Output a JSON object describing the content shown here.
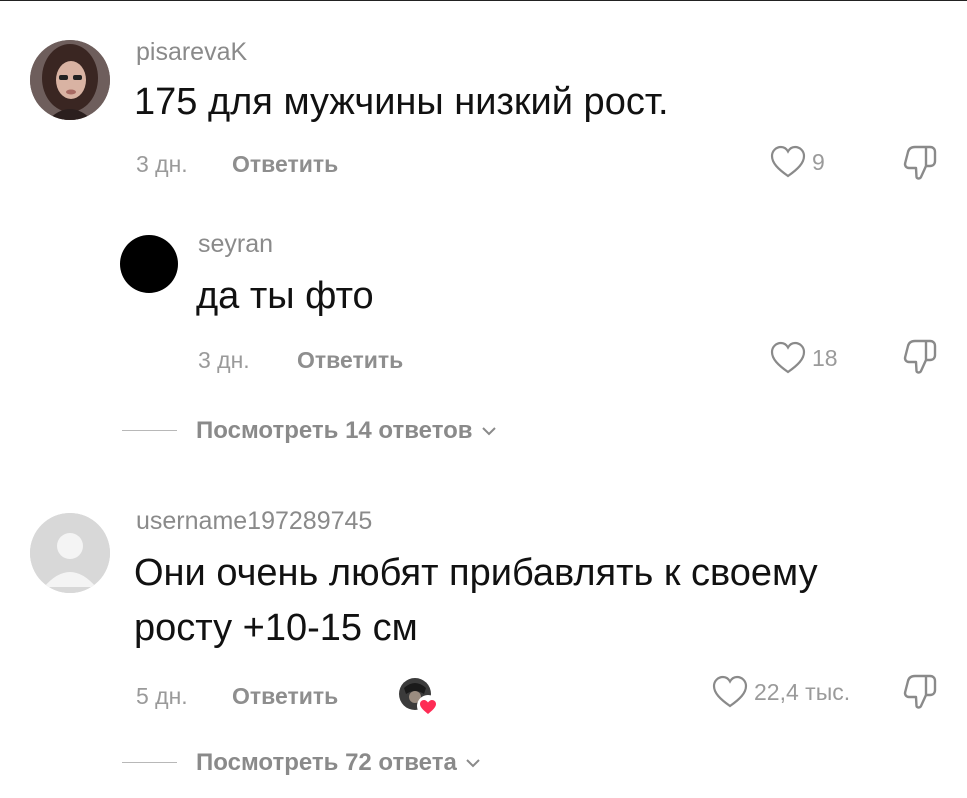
{
  "comments": [
    {
      "username": "pisarevaK",
      "text": "175 для мужчины низкий рост.",
      "time": "3 дн.",
      "reply_label": "Ответить",
      "likes": "9"
    },
    {
      "username": "seyran",
      "text": "да ты фто",
      "time": "3 дн.",
      "reply_label": "Ответить",
      "likes": "18"
    },
    {
      "username": "username197289745",
      "text_line1": "Они очень любят прибавлять к своему",
      "text_line2": "росту +10-15 см",
      "time": "5 дн.",
      "reply_label": "Ответить",
      "likes": "22,4 тыс."
    }
  ],
  "view_replies": [
    {
      "label": "Посмотреть 14 ответов"
    },
    {
      "label": "Посмотреть 72 ответа"
    }
  ],
  "icons": {
    "like": "heart-outline-icon",
    "dislike": "thumbs-down-outline-icon",
    "expand": "chevron-down-icon",
    "creator_like": "creator-liked-heart-icon"
  },
  "colors": {
    "text": "#111111",
    "muted": "#8a8a8a",
    "creator_heart": "#fe2c55"
  }
}
